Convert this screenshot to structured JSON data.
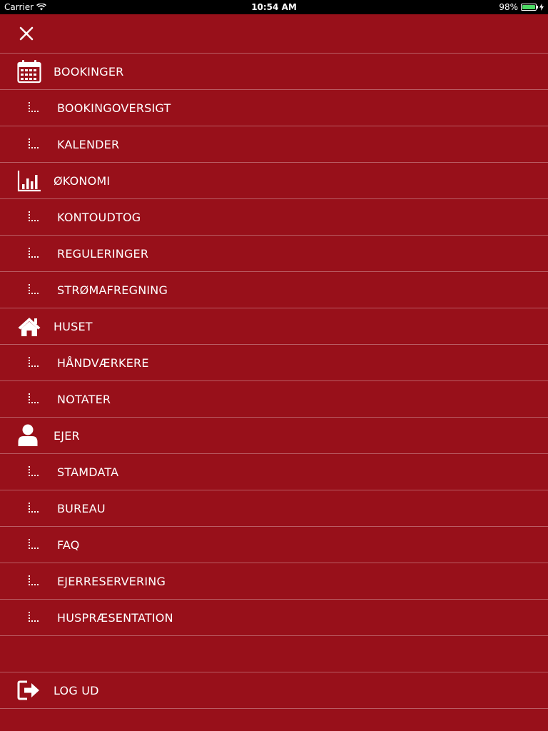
{
  "status_bar": {
    "carrier": "Carrier",
    "time": "10:54 AM",
    "battery": "98%",
    "battery_level": 0.98
  },
  "menu": {
    "sections": [
      {
        "label": "BOOKINGER",
        "icon": "calendar-icon",
        "children": [
          "BOOKINGOVERSIGT",
          "KALENDER"
        ]
      },
      {
        "label": "ØKONOMI",
        "icon": "bar-chart-icon",
        "children": [
          "KONTOUDTOG",
          "REGULERINGER",
          "STRØMAFREGNING"
        ]
      },
      {
        "label": "HUSET",
        "icon": "house-icon",
        "children": [
          "HÅNDVÆRKERE",
          "NOTATER"
        ]
      },
      {
        "label": "EJER",
        "icon": "user-icon",
        "children": [
          "STAMDATA",
          "BUREAU",
          "FAQ",
          "EJERRESERVERING",
          "HUSPRÆSENTATION"
        ]
      }
    ],
    "logout": {
      "label": "LOG UD",
      "icon": "logout-icon"
    }
  },
  "colors": {
    "background": "#98101a",
    "divider": "#c4585f",
    "text": "#ffffff"
  }
}
